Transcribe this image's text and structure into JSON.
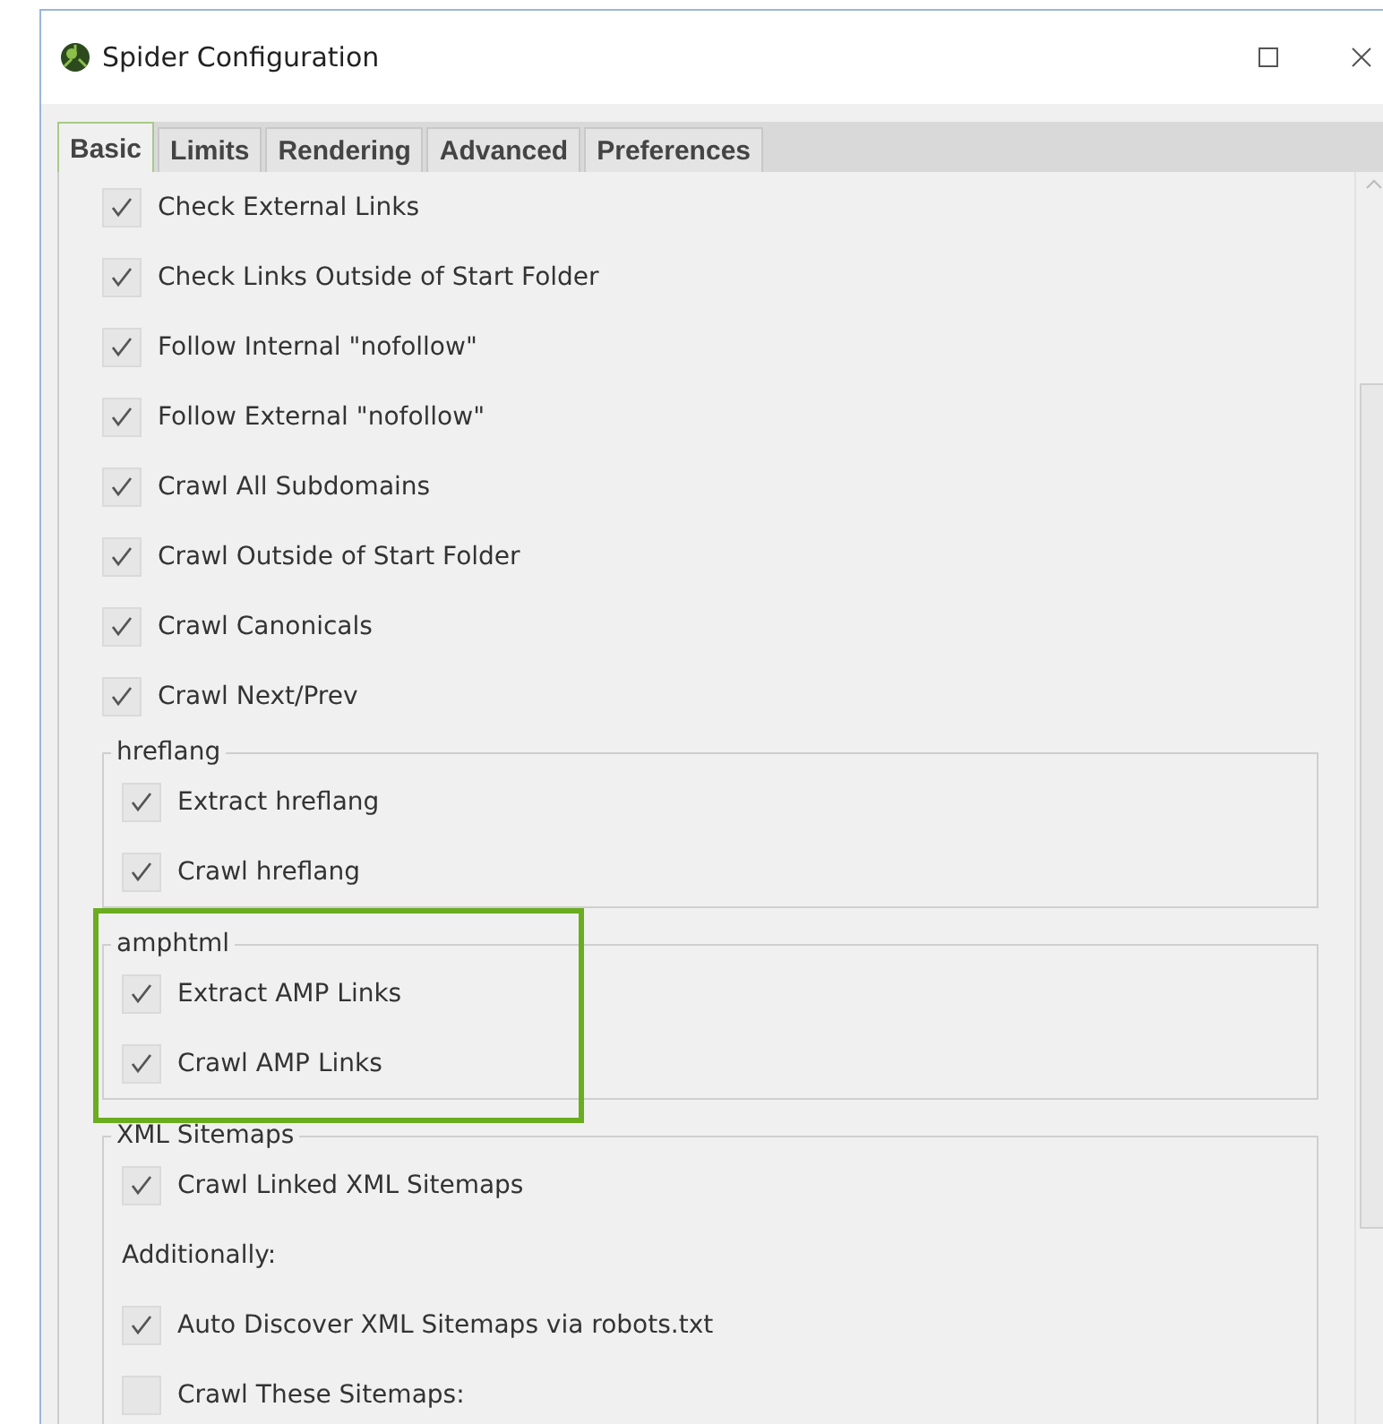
{
  "window": {
    "title": "Spider Configuration"
  },
  "tabs": [
    {
      "label": "Basic",
      "selected": true
    },
    {
      "label": "Limits",
      "selected": false
    },
    {
      "label": "Rendering",
      "selected": false
    },
    {
      "label": "Advanced",
      "selected": false
    },
    {
      "label": "Preferences",
      "selected": false
    }
  ],
  "content": [
    {
      "kind": "checkbox",
      "label": "Check External Links",
      "checked": true
    },
    {
      "kind": "checkbox",
      "label": "Check Links Outside of Start Folder",
      "checked": true
    },
    {
      "kind": "checkbox",
      "label": "Follow Internal \"nofollow\"",
      "checked": true
    },
    {
      "kind": "checkbox",
      "label": "Follow External \"nofollow\"",
      "checked": true
    },
    {
      "kind": "checkbox",
      "label": "Crawl All Subdomains",
      "checked": true
    },
    {
      "kind": "checkbox",
      "label": "Crawl Outside of Start Folder",
      "checked": true
    },
    {
      "kind": "checkbox",
      "label": "Crawl Canonicals",
      "checked": true
    },
    {
      "kind": "checkbox",
      "label": "Crawl Next/Prev",
      "checked": true
    },
    {
      "kind": "group",
      "title": "hreflang",
      "highlighted": false,
      "items": [
        {
          "kind": "checkbox",
          "label": "Extract hreflang",
          "checked": true
        },
        {
          "kind": "checkbox",
          "label": "Crawl hreflang",
          "checked": true
        }
      ]
    },
    {
      "kind": "group",
      "title": "amphtml",
      "highlighted": true,
      "items": [
        {
          "kind": "checkbox",
          "label": "Extract AMP Links",
          "checked": true
        },
        {
          "kind": "checkbox",
          "label": "Crawl AMP Links",
          "checked": true
        }
      ]
    },
    {
      "kind": "group",
      "title": "XML Sitemaps",
      "highlighted": false,
      "items": [
        {
          "kind": "checkbox",
          "label": "Crawl Linked XML Sitemaps",
          "checked": true
        },
        {
          "kind": "note",
          "label": "Additionally:"
        },
        {
          "kind": "checkbox",
          "label": "Auto Discover XML Sitemaps via robots.txt",
          "checked": true
        },
        {
          "kind": "checkbox",
          "label": "Crawl These Sitemaps:",
          "checked": false
        }
      ]
    }
  ]
}
